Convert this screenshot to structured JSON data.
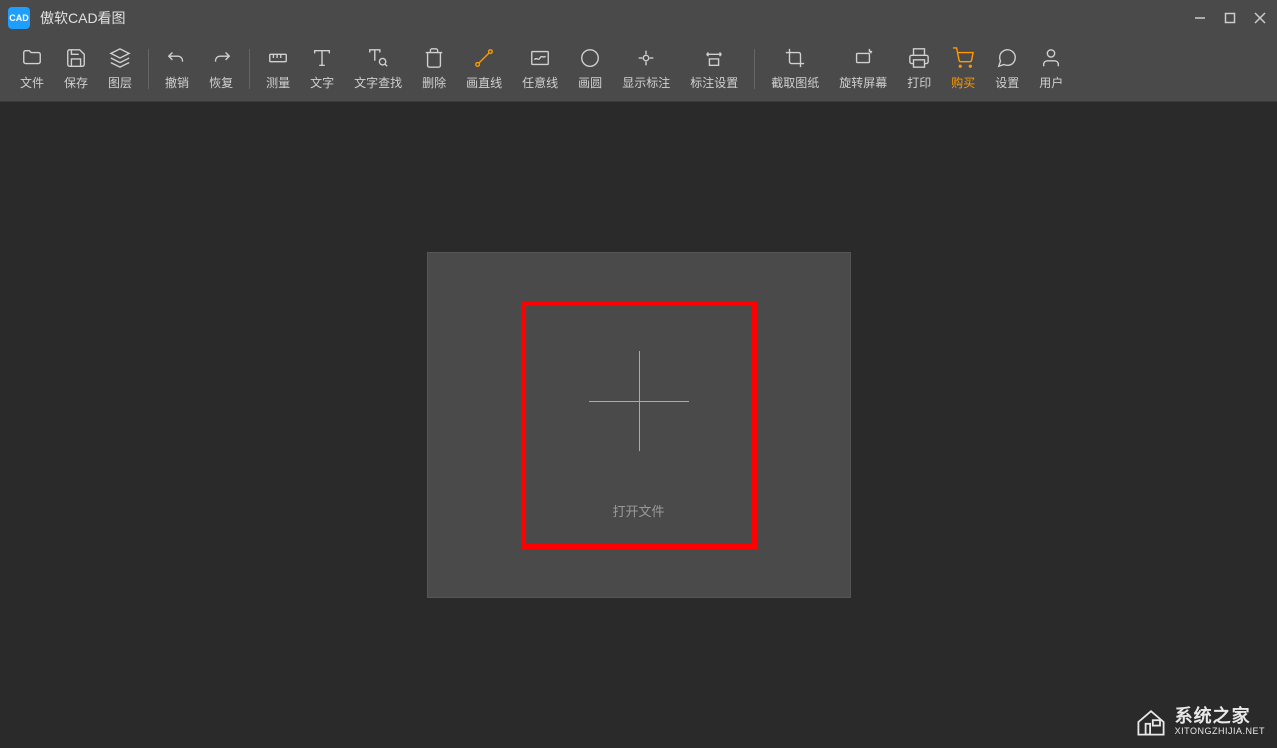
{
  "app": {
    "title": "傲软CAD看图",
    "logo_text": "CAD"
  },
  "toolbar": {
    "file": "文件",
    "save": "保存",
    "layer": "图层",
    "undo": "撤销",
    "redo": "恢复",
    "measure": "测量",
    "text": "文字",
    "text_find": "文字查找",
    "delete": "删除",
    "line": "画直线",
    "polyline": "任意线",
    "circle": "画圆",
    "show_annotation": "显示标注",
    "annotation_settings": "标注设置",
    "capture": "截取图纸",
    "rotate": "旋转屏幕",
    "print": "打印",
    "buy": "购买",
    "settings": "设置",
    "user": "用户"
  },
  "main": {
    "open_file": "打开文件"
  },
  "watermark": {
    "cn": "系统之家",
    "en": "XITONGZHIJIA.NET"
  }
}
